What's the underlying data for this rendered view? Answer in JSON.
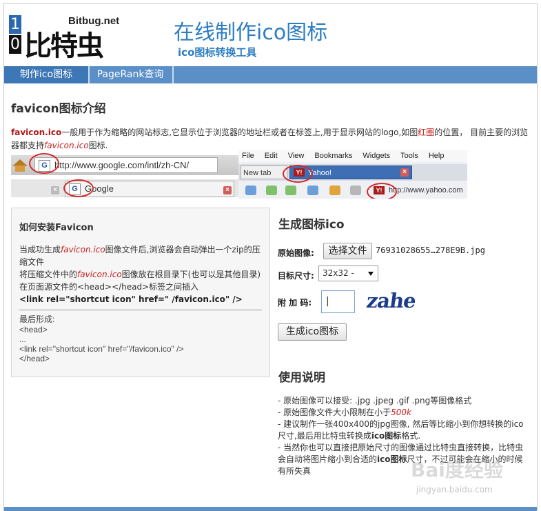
{
  "header": {
    "logo_digit_top": "1",
    "logo_digit_bottom": "0",
    "logo_domain": "Bitbug.net",
    "logo_name": "比特虫",
    "title": "在线制作ico图标",
    "subtitle": "ico图标转换工具"
  },
  "nav": {
    "items": [
      {
        "label": "制作ico图标"
      },
      {
        "label": "PageRank查询"
      }
    ]
  },
  "intro": {
    "heading": "favicon图标介绍",
    "term": "favicon.ico",
    "text_a": "一般用于作为缩略的网站标志,它显示位于浏览器的地址栏或者在标签上,用于显示网站的logo,如图",
    "red_circle": "红圈",
    "text_b": "的位置， 目前主要的浏览器都支持",
    "term_italic": "favicon.ico",
    "text_c": "图标."
  },
  "screenshot": {
    "ff_url": "http://www.google.com/intl/zh-CN/",
    "ff_tab": "Google",
    "g_letter": "G",
    "opera_menu": [
      "File",
      "Edit",
      "View",
      "Bookmarks",
      "Widgets",
      "Tools",
      "Help"
    ],
    "opera_tab1": "New tab",
    "opera_tab2": "Yahoo!",
    "opera_url": "http://www.yahoo.com",
    "y_icon": "Y!"
  },
  "install": {
    "title": "如何安装Favicon",
    "l1a": "当成功生成",
    "l1term": "favicon.ico",
    "l1b": "图像文件后,浏览器会自动弹出一个zip的压缩文件",
    "l2a": "将压缩文件中的",
    "l2term": "favicon.ico",
    "l2b": "图像放在根目录下(也可以是其他目录)",
    "l3": "在页面源文件的<head></head>标签之间插入",
    "code": "<link rel=\"shortcut icon\" href=\" /favicon.ico\" />",
    "result_label": "最后形成:",
    "r1": "<head>",
    "r2": "...",
    "r3": "<link rel=\"shortcut icon\" href=\"/favicon.ico\" />",
    "r4": "</head>"
  },
  "generate": {
    "heading": "生成图标ico",
    "source_label": "原始图像:",
    "choose_button": "选择文件",
    "filename": "76931028655…278E9B.jpg",
    "size_label": "目标尺寸:",
    "size_value": "32x32 -",
    "code_label": "附 加 码:",
    "code_value": "|",
    "captcha": "zahe",
    "submit_button": "生成ico图标"
  },
  "usage": {
    "heading": "使用说明",
    "i1": "- 原始图像可以接受: .jpg .jpeg .gif .png等图像格式",
    "i2a": "- 原始图像文件大小限制在小于",
    "i2b": "500k",
    "i3a": "- 建议制作一张400x400的jpg图像, 然后等比缩小到你想转换的ico尺寸,最后用比特虫转换成",
    "i3b": "ico图标",
    "i3c": "格式.",
    "i4a": "- 当然你也可以直接把原始尺寸的图像通过比特虫直接转换，比特虫会自动将图片缩小到合适的",
    "i4b": "ico图标",
    "i4c": "尺寸，不过可能会在缩小的时候有所失真"
  },
  "watermark": {
    "text": "Bai度经验",
    "url": "jingyan.baidu.com"
  },
  "colors": {
    "brand_blue": "#2c7dc2",
    "nav_blue": "#5a8fc7",
    "accent_red": "#c62020"
  }
}
